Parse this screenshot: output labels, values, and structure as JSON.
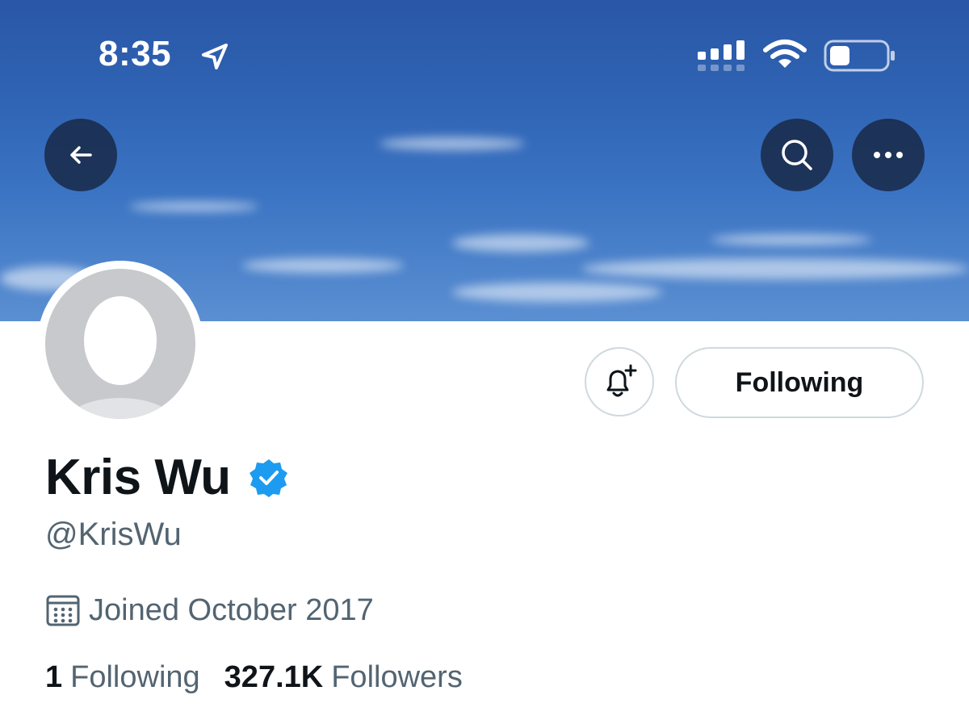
{
  "status_bar": {
    "time": "8:35"
  },
  "profile": {
    "display_name": "Kris Wu",
    "handle": "@KrisWu",
    "joined": "Joined October 2017",
    "following_count": "1",
    "following_label": "Following",
    "followers_count": "327.1K",
    "followers_label": "Followers"
  },
  "actions": {
    "follow_state_label": "Following"
  },
  "icons": {
    "back": "arrow-left-icon",
    "search": "search-icon",
    "more": "more-horizontal-icon",
    "notify": "bell-plus-icon",
    "verified": "verified-badge-icon",
    "calendar": "calendar-icon",
    "location": "location-arrow-icon",
    "signal": "cellular-signal-icon",
    "wifi": "wifi-icon",
    "battery": "battery-icon"
  },
  "colors": {
    "verified_blue": "#1d9bf0",
    "text_primary": "#0f1419",
    "text_secondary": "#536471",
    "border": "#cfd9de"
  }
}
